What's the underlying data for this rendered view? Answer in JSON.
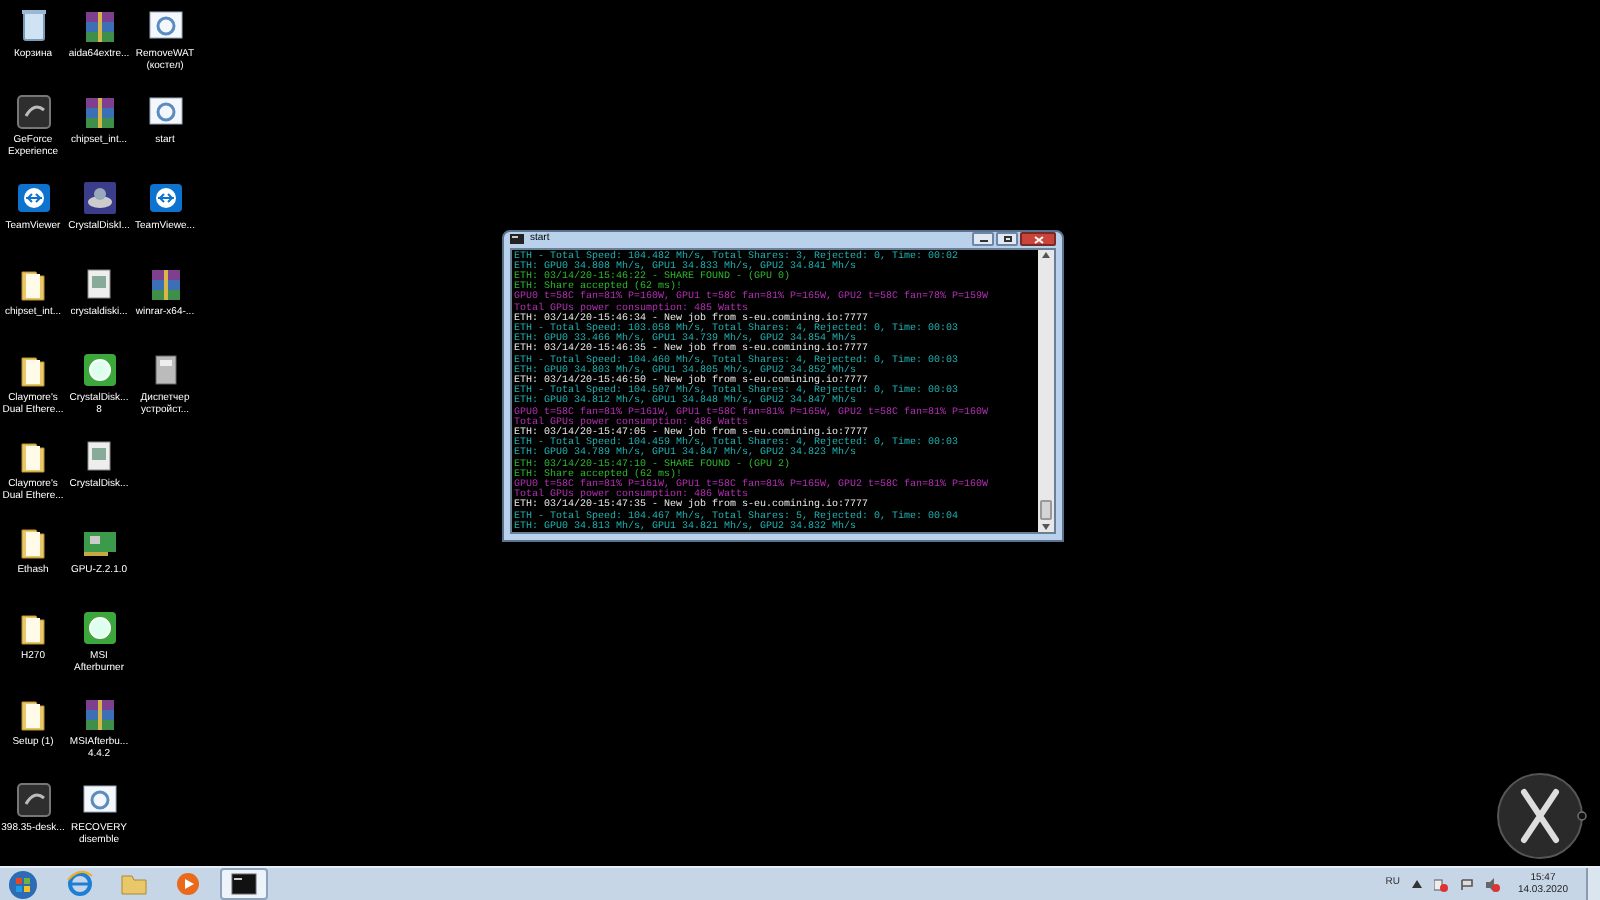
{
  "desktop_icons": [
    {
      "label": "Корзина",
      "kind": "trash"
    },
    {
      "label": "GeForce Experience",
      "kind": "nvidia"
    },
    {
      "label": "TeamViewer",
      "kind": "teamviewer"
    },
    {
      "label": "chipset_int...",
      "kind": "folder"
    },
    {
      "label": "Claymore's Dual Ethere...",
      "kind": "folder"
    },
    {
      "label": "Claymore's Dual Ethere...",
      "kind": "folder"
    },
    {
      "label": "Ethash",
      "kind": "folder"
    },
    {
      "label": "H270",
      "kind": "folder"
    },
    {
      "label": "Setup (1)",
      "kind": "folder"
    },
    {
      "label": "398.35-desk...",
      "kind": "nvidia"
    },
    {
      "label": "aida64extre...",
      "kind": "archive"
    },
    {
      "label": "chipset_int...",
      "kind": "archive"
    },
    {
      "label": "CrystalDiskI...",
      "kind": "disk"
    },
    {
      "label": "crystaldiski...",
      "kind": "document"
    },
    {
      "label": "CrystalDisk... 8",
      "kind": "green"
    },
    {
      "label": "CrystalDisk...",
      "kind": "document"
    },
    {
      "label": "GPU-Z.2.1.0",
      "kind": "card"
    },
    {
      "label": "MSI Afterburner",
      "kind": "green"
    },
    {
      "label": "MSIAfterbu... 4.4.2",
      "kind": "archive"
    },
    {
      "label": "RECOVERY disemble",
      "kind": "settings"
    },
    {
      "label": "RemoveWAT (костел)",
      "kind": "settings"
    },
    {
      "label": "start",
      "kind": "settings"
    },
    {
      "label": "TeamViewe...",
      "kind": "teamviewer"
    },
    {
      "label": "winrar-x64-...",
      "kind": "archive"
    },
    {
      "label": "Диспетчер устройст...",
      "kind": "device"
    }
  ],
  "console_window": {
    "title": "start",
    "lines": [
      {
        "kind": "info",
        "text": "ETH - Total Speed: 104.482 Mh/s, Total Shares: 3, Rejected: 0, Time: 00:02"
      },
      {
        "kind": "info",
        "text": "ETH: GPU0 34.808 Mh/s, GPU1 34.833 Mh/s, GPU2 34.841 Mh/s"
      },
      {
        "kind": "share",
        "text": "ETH: 03/14/20-15:46:22 - SHARE FOUND - (GPU 0)"
      },
      {
        "kind": "share",
        "text": "ETH: Share accepted (62 ms)!"
      },
      {
        "kind": "gpu",
        "text": "GPU0 t=58C fan=81% P=160W, GPU1 t=58C fan=81% P=165W, GPU2 t=58C fan=78% P=159W"
      },
      {
        "kind": "gpu",
        "text": "Total GPUs power consumption: 485 Watts"
      },
      {
        "kind": "job",
        "text": "ETH: 03/14/20-15:46:34 - New job from s-eu.comining.io:7777"
      },
      {
        "kind": "info",
        "text": "ETH - Total Speed: 103.058 Mh/s, Total Shares: 4, Rejected: 0, Time: 00:03"
      },
      {
        "kind": "info",
        "text": "ETH: GPU0 33.466 Mh/s, GPU1 34.739 Mh/s, GPU2 34.854 Mh/s"
      },
      {
        "kind": "job",
        "text": "ETH: 03/14/20-15:46:35 - New job from s-eu.comining.io:7777"
      },
      {
        "kind": "info",
        "text": "ETH - Total Speed: 104.460 Mh/s, Total Shares: 4, Rejected: 0, Time: 00:03"
      },
      {
        "kind": "info",
        "text": "ETH: GPU0 34.803 Mh/s, GPU1 34.805 Mh/s, GPU2 34.852 Mh/s"
      },
      {
        "kind": "job",
        "text": "ETH: 03/14/20-15:46:50 - New job from s-eu.comining.io:7777"
      },
      {
        "kind": "info",
        "text": "ETH - Total Speed: 104.507 Mh/s, Total Shares: 4, Rejected: 0, Time: 00:03"
      },
      {
        "kind": "info",
        "text": "ETH: GPU0 34.812 Mh/s, GPU1 34.848 Mh/s, GPU2 34.847 Mh/s"
      },
      {
        "kind": "gpu",
        "text": "GPU0 t=58C fan=81% P=161W, GPU1 t=58C fan=81% P=165W, GPU2 t=58C fan=81% P=160W"
      },
      {
        "kind": "gpu",
        "text": "Total GPUs power consumption: 486 Watts"
      },
      {
        "kind": "job",
        "text": "ETH: 03/14/20-15:47:05 - New job from s-eu.comining.io:7777"
      },
      {
        "kind": "info",
        "text": "ETH - Total Speed: 104.459 Mh/s, Total Shares: 4, Rejected: 0, Time: 00:03"
      },
      {
        "kind": "info",
        "text": "ETH: GPU0 34.789 Mh/s, GPU1 34.847 Mh/s, GPU2 34.823 Mh/s"
      },
      {
        "kind": "share",
        "text": "ETH: 03/14/20-15:47:10 - SHARE FOUND - (GPU 2)"
      },
      {
        "kind": "share",
        "text": "ETH: Share accepted (62 ms)!"
      },
      {
        "kind": "gpu",
        "text": "GPU0 t=58C fan=81% P=161W, GPU1 t=58C fan=81% P=165W, GPU2 t=58C fan=81% P=160W"
      },
      {
        "kind": "gpu",
        "text": "Total GPUs power consumption: 486 Watts"
      },
      {
        "kind": "job",
        "text": "ETH: 03/14/20-15:47:35 - New job from s-eu.comining.io:7777"
      },
      {
        "kind": "info",
        "text": "ETH - Total Speed: 104.467 Mh/s, Total Shares: 5, Rejected: 0, Time: 00:04"
      },
      {
        "kind": "info",
        "text": "ETH: GPU0 34.813 Mh/s, GPU1 34.821 Mh/s, GPU2 34.832 Mh/s"
      }
    ]
  },
  "taskbar": {
    "apps": [
      {
        "kind": "ie",
        "selected": false
      },
      {
        "kind": "explorer",
        "selected": false
      },
      {
        "kind": "media",
        "selected": false
      },
      {
        "kind": "console",
        "selected": true
      }
    ],
    "language": "RU",
    "time": "15:47",
    "date": "14.03.2020"
  }
}
